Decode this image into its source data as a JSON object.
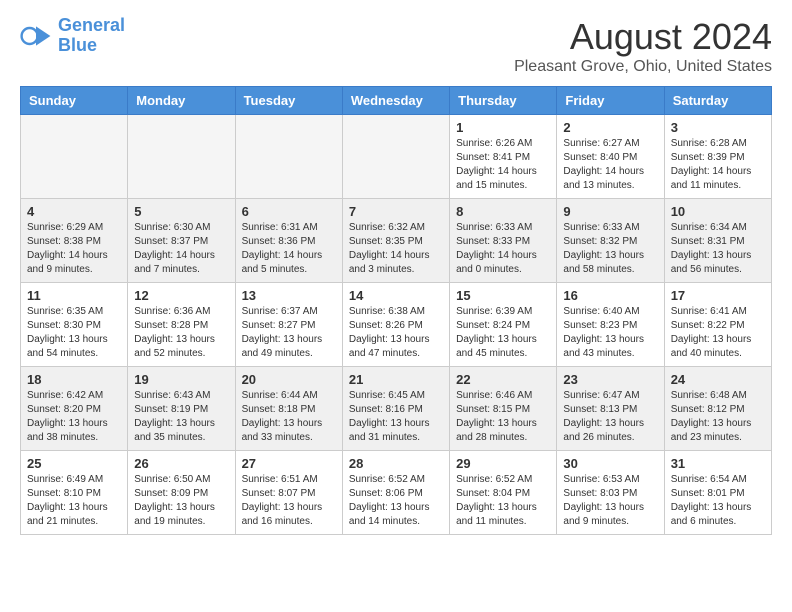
{
  "logo": {
    "line1": "General",
    "line2": "Blue"
  },
  "title": "August 2024",
  "subtitle": "Pleasant Grove, Ohio, United States",
  "days_of_week": [
    "Sunday",
    "Monday",
    "Tuesday",
    "Wednesday",
    "Thursday",
    "Friday",
    "Saturday"
  ],
  "weeks": [
    [
      {
        "day": "",
        "info": ""
      },
      {
        "day": "",
        "info": ""
      },
      {
        "day": "",
        "info": ""
      },
      {
        "day": "",
        "info": ""
      },
      {
        "day": "1",
        "info": "Sunrise: 6:26 AM\nSunset: 8:41 PM\nDaylight: 14 hours and 15 minutes."
      },
      {
        "day": "2",
        "info": "Sunrise: 6:27 AM\nSunset: 8:40 PM\nDaylight: 14 hours and 13 minutes."
      },
      {
        "day": "3",
        "info": "Sunrise: 6:28 AM\nSunset: 8:39 PM\nDaylight: 14 hours and 11 minutes."
      }
    ],
    [
      {
        "day": "4",
        "info": "Sunrise: 6:29 AM\nSunset: 8:38 PM\nDaylight: 14 hours and 9 minutes."
      },
      {
        "day": "5",
        "info": "Sunrise: 6:30 AM\nSunset: 8:37 PM\nDaylight: 14 hours and 7 minutes."
      },
      {
        "day": "6",
        "info": "Sunrise: 6:31 AM\nSunset: 8:36 PM\nDaylight: 14 hours and 5 minutes."
      },
      {
        "day": "7",
        "info": "Sunrise: 6:32 AM\nSunset: 8:35 PM\nDaylight: 14 hours and 3 minutes."
      },
      {
        "day": "8",
        "info": "Sunrise: 6:33 AM\nSunset: 8:33 PM\nDaylight: 14 hours and 0 minutes."
      },
      {
        "day": "9",
        "info": "Sunrise: 6:33 AM\nSunset: 8:32 PM\nDaylight: 13 hours and 58 minutes."
      },
      {
        "day": "10",
        "info": "Sunrise: 6:34 AM\nSunset: 8:31 PM\nDaylight: 13 hours and 56 minutes."
      }
    ],
    [
      {
        "day": "11",
        "info": "Sunrise: 6:35 AM\nSunset: 8:30 PM\nDaylight: 13 hours and 54 minutes."
      },
      {
        "day": "12",
        "info": "Sunrise: 6:36 AM\nSunset: 8:28 PM\nDaylight: 13 hours and 52 minutes."
      },
      {
        "day": "13",
        "info": "Sunrise: 6:37 AM\nSunset: 8:27 PM\nDaylight: 13 hours and 49 minutes."
      },
      {
        "day": "14",
        "info": "Sunrise: 6:38 AM\nSunset: 8:26 PM\nDaylight: 13 hours and 47 minutes."
      },
      {
        "day": "15",
        "info": "Sunrise: 6:39 AM\nSunset: 8:24 PM\nDaylight: 13 hours and 45 minutes."
      },
      {
        "day": "16",
        "info": "Sunrise: 6:40 AM\nSunset: 8:23 PM\nDaylight: 13 hours and 43 minutes."
      },
      {
        "day": "17",
        "info": "Sunrise: 6:41 AM\nSunset: 8:22 PM\nDaylight: 13 hours and 40 minutes."
      }
    ],
    [
      {
        "day": "18",
        "info": "Sunrise: 6:42 AM\nSunset: 8:20 PM\nDaylight: 13 hours and 38 minutes."
      },
      {
        "day": "19",
        "info": "Sunrise: 6:43 AM\nSunset: 8:19 PM\nDaylight: 13 hours and 35 minutes."
      },
      {
        "day": "20",
        "info": "Sunrise: 6:44 AM\nSunset: 8:18 PM\nDaylight: 13 hours and 33 minutes."
      },
      {
        "day": "21",
        "info": "Sunrise: 6:45 AM\nSunset: 8:16 PM\nDaylight: 13 hours and 31 minutes."
      },
      {
        "day": "22",
        "info": "Sunrise: 6:46 AM\nSunset: 8:15 PM\nDaylight: 13 hours and 28 minutes."
      },
      {
        "day": "23",
        "info": "Sunrise: 6:47 AM\nSunset: 8:13 PM\nDaylight: 13 hours and 26 minutes."
      },
      {
        "day": "24",
        "info": "Sunrise: 6:48 AM\nSunset: 8:12 PM\nDaylight: 13 hours and 23 minutes."
      }
    ],
    [
      {
        "day": "25",
        "info": "Sunrise: 6:49 AM\nSunset: 8:10 PM\nDaylight: 13 hours and 21 minutes."
      },
      {
        "day": "26",
        "info": "Sunrise: 6:50 AM\nSunset: 8:09 PM\nDaylight: 13 hours and 19 minutes."
      },
      {
        "day": "27",
        "info": "Sunrise: 6:51 AM\nSunset: 8:07 PM\nDaylight: 13 hours and 16 minutes."
      },
      {
        "day": "28",
        "info": "Sunrise: 6:52 AM\nSunset: 8:06 PM\nDaylight: 13 hours and 14 minutes."
      },
      {
        "day": "29",
        "info": "Sunrise: 6:52 AM\nSunset: 8:04 PM\nDaylight: 13 hours and 11 minutes."
      },
      {
        "day": "30",
        "info": "Sunrise: 6:53 AM\nSunset: 8:03 PM\nDaylight: 13 hours and 9 minutes."
      },
      {
        "day": "31",
        "info": "Sunrise: 6:54 AM\nSunset: 8:01 PM\nDaylight: 13 hours and 6 minutes."
      }
    ]
  ]
}
